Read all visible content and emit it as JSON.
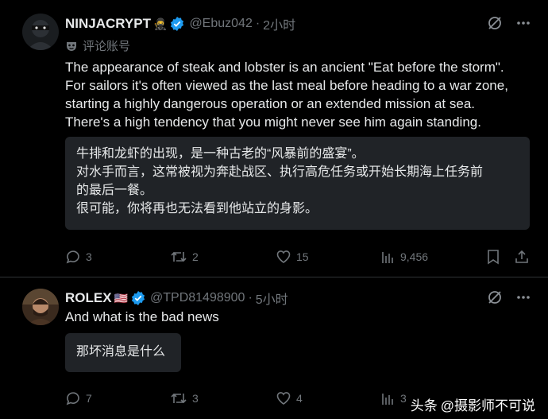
{
  "tweets": [
    {
      "name": "NINJACRYPT",
      "name_emoji": "🥷",
      "handle": "@Ebuz042",
      "time": "2小时",
      "label": "评论账号",
      "text_lines": [
        "The appearance of steak and lobster is an ancient \"Eat before the storm\".",
        "For sailors it's often viewed as the last meal before heading to a war zone,",
        "starting a highly dangerous operation or an extended mission at sea.",
        "There's a high tendency that you might never see him again standing."
      ],
      "translation_lines": [
        "牛排和龙虾的出现，是一种古老的“风暴前的盛宴”。",
        "对水手而言，这常被视为奔赴战区、执行高危任务或开始长期海上任务前",
        "的最后一餐。",
        "很可能，你将再也无法看到他站立的身影。"
      ],
      "replies": "3",
      "retweets": "2",
      "likes": "15",
      "views": "9,456"
    },
    {
      "name": "ROLEX",
      "name_emoji": "🇺🇸",
      "handle": "@TPD81498900",
      "time": "5小时",
      "text_lines": [
        "And what is the bad news"
      ],
      "translation_lines": [
        "那坏消息是什么"
      ],
      "replies": "7",
      "retweets": "3",
      "likes": "4",
      "views": "3"
    }
  ],
  "separator": "·",
  "watermark": {
    "platform": "头条",
    "account": "@摄影师不可说"
  },
  "colors": {
    "background": "#000000",
    "text": "#e7e9ea",
    "muted": "#71767b",
    "verified": "#1d9bf0",
    "translation_box": "#202327"
  }
}
